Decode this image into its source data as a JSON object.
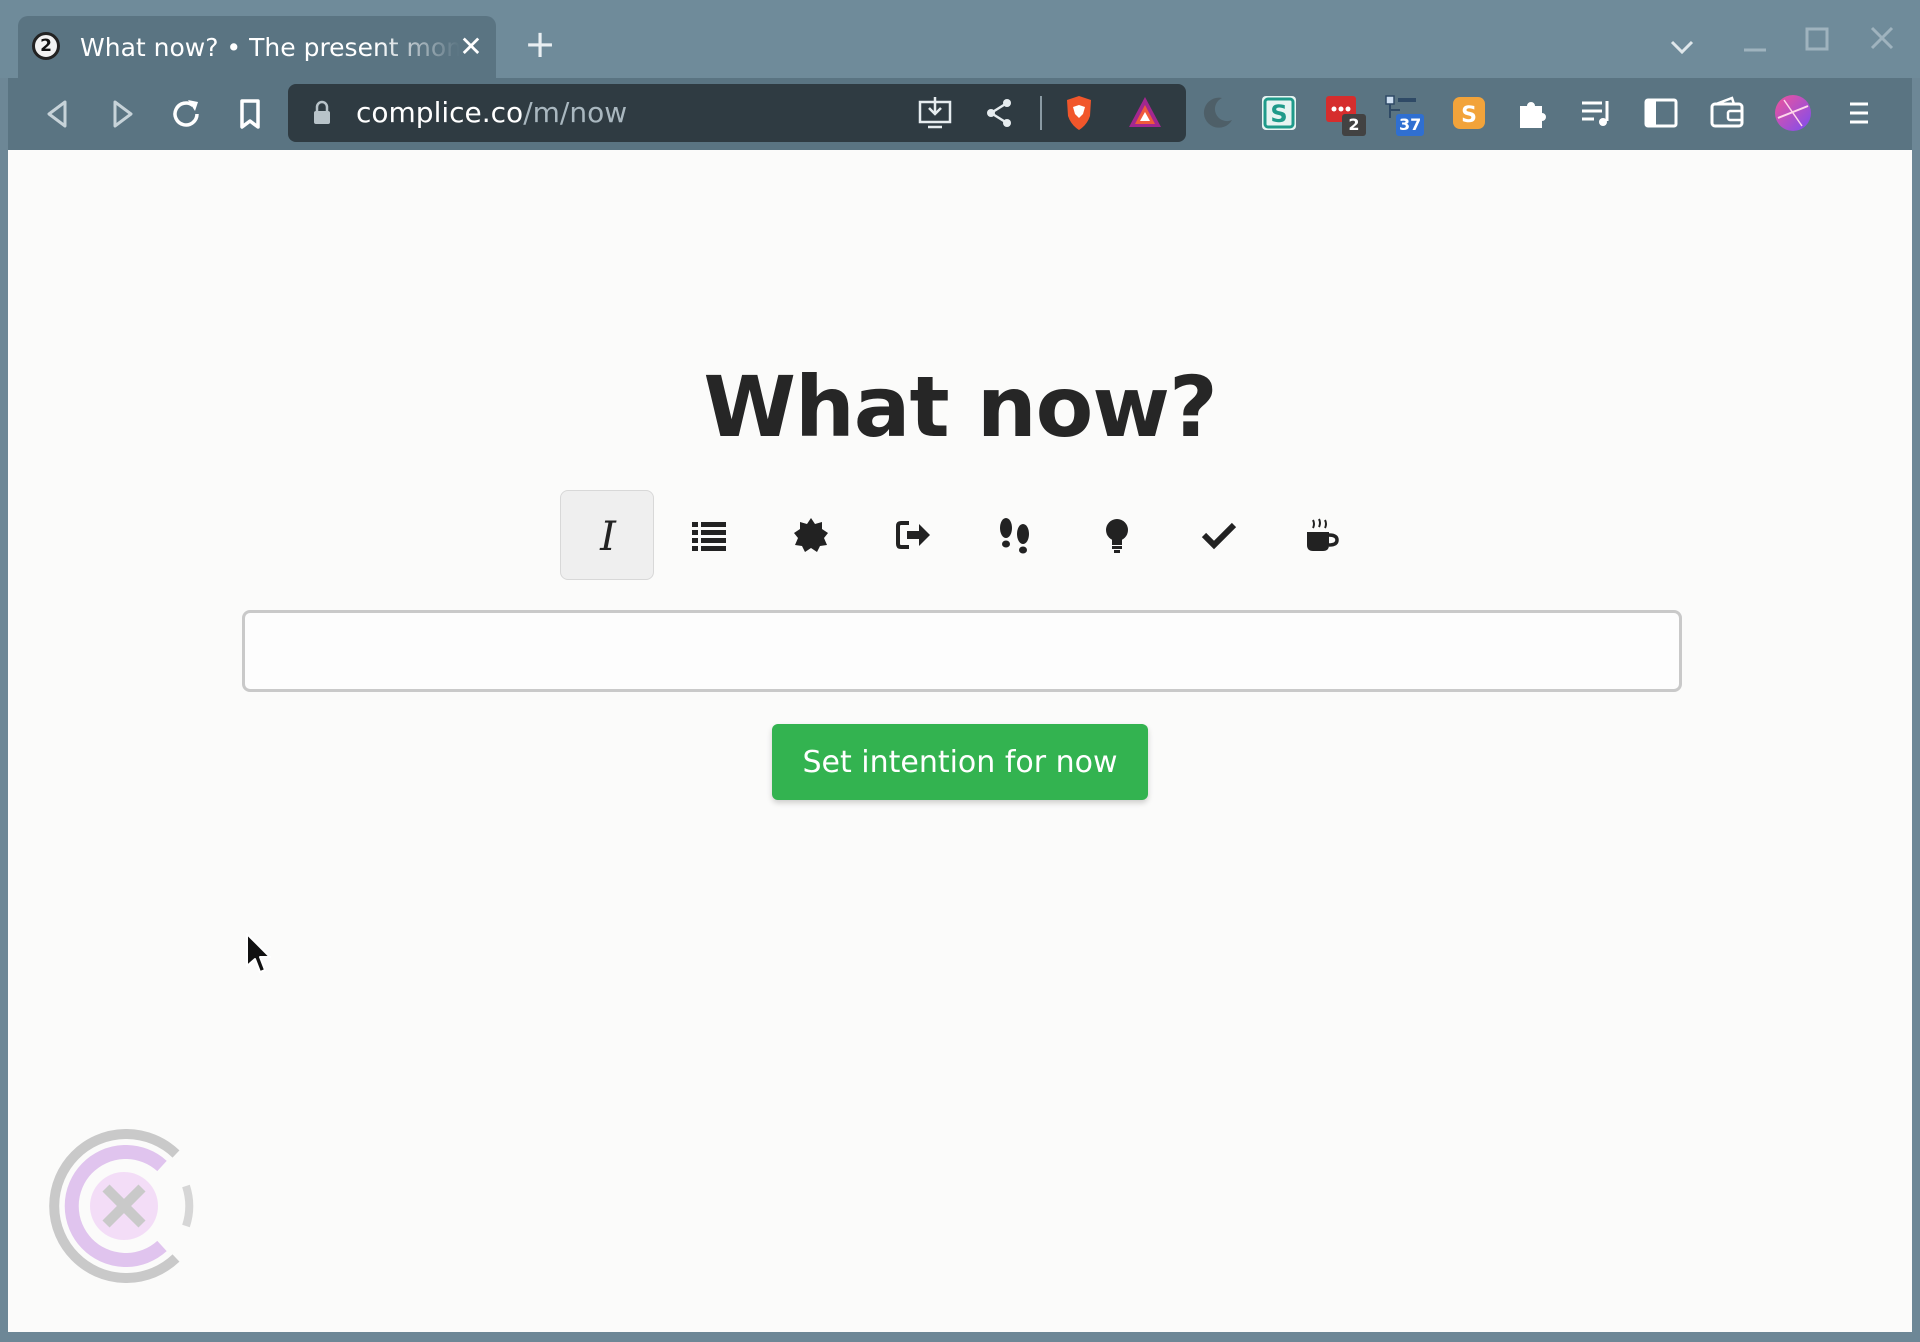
{
  "browser": {
    "tab": {
      "favicon_label": "2",
      "title": "What now? • The present moment"
    },
    "url": {
      "host": "complice.co",
      "path": "/m/now"
    },
    "extensions": [
      {
        "name": "night-mode-icon"
      },
      {
        "name": "s-extension-icon",
        "color": "#1f9a8a"
      },
      {
        "name": "red-extension-icon",
        "badge": "2",
        "color": "#d62d2d"
      },
      {
        "name": "tree-extension-icon",
        "badge": "37",
        "color": "#2f6fd1"
      },
      {
        "name": "orange-s-extension-icon",
        "color": "#f2a33a"
      },
      {
        "name": "puzzle-icon"
      },
      {
        "name": "playlist-icon"
      },
      {
        "name": "sidebar-icon"
      },
      {
        "name": "wallet-icon"
      },
      {
        "name": "profile-avatar"
      },
      {
        "name": "menu-icon"
      }
    ]
  },
  "page": {
    "heading": "What now?",
    "modes": [
      {
        "name": "intention-mode",
        "active": true
      },
      {
        "name": "list-mode"
      },
      {
        "name": "badge-mode"
      },
      {
        "name": "exit-mode"
      },
      {
        "name": "footsteps-mode"
      },
      {
        "name": "lightbulb-mode"
      },
      {
        "name": "check-mode"
      },
      {
        "name": "coffee-mode"
      }
    ],
    "input_value": "",
    "submit_label": "Set intention for now",
    "accent_color": "#33b350"
  }
}
